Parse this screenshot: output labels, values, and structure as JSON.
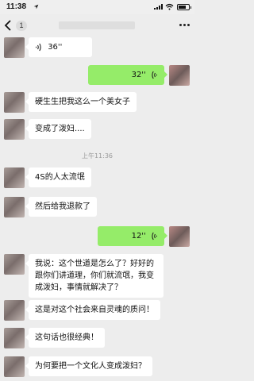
{
  "status_bar": {
    "time": "11:38"
  },
  "nav": {
    "unread_count": "1"
  },
  "messages": {
    "m1_voice_duration": "36''",
    "m2_voice_duration": "32''",
    "m3_text": "硬生生把我这么一个美女子",
    "m4_text": "变成了泼妇....",
    "timestamp": "上午11:36",
    "m5_text": "4S的人太流氓",
    "m6_text": "然后给我退款了",
    "m7_voice_duration": "12''",
    "m8_text": "我说：这个世道是怎么了？好好的跟你们讲道理，你们就流氓，我变成泼妇，事情就解决了？",
    "m9_text": "这是对这个社会来自灵魂的质问！",
    "m10_text": "这句话也很经典！",
    "m11_text": "为何要把一个文化人变成泼妇？"
  },
  "colors": {
    "sent_bubble": "#95ec69",
    "received_bubble": "#ffffff",
    "background": "#ededed"
  }
}
